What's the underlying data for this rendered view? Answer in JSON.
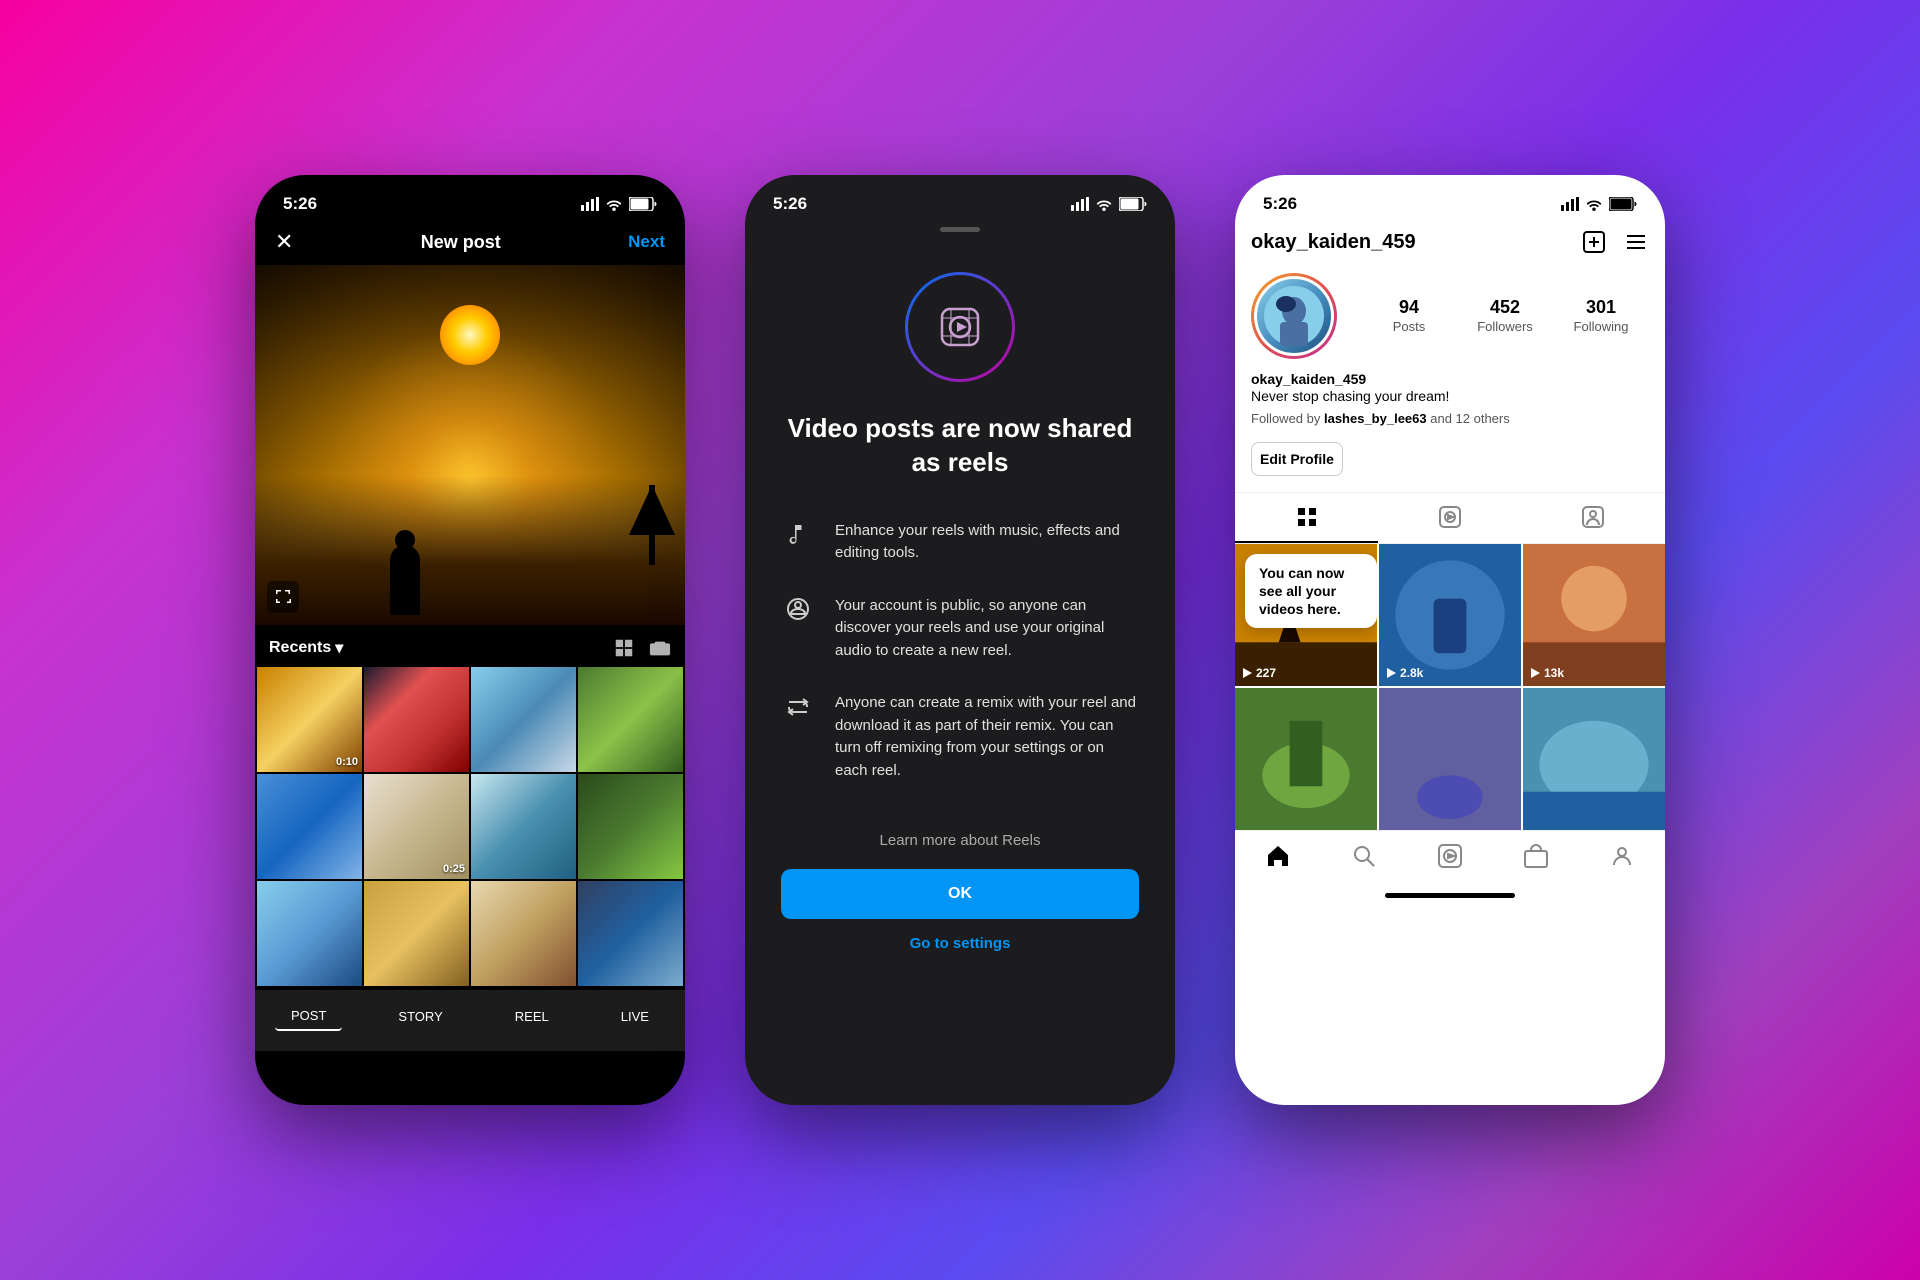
{
  "background": {
    "gradient": "pink-purple-blue"
  },
  "phone1": {
    "status_time": "5:26",
    "nav_title": "New post",
    "nav_next": "Next",
    "recents_label": "Recents",
    "photo_grid": [
      {
        "id": 1,
        "class": "gi-1",
        "duration": "0:10"
      },
      {
        "id": 2,
        "class": "gi-2",
        "duration": ""
      },
      {
        "id": 3,
        "class": "gi-3",
        "duration": ""
      },
      {
        "id": 4,
        "class": "gi-4",
        "duration": ""
      },
      {
        "id": 5,
        "class": "gi-5",
        "duration": ""
      },
      {
        "id": 6,
        "class": "gi-6",
        "duration": "0:25"
      },
      {
        "id": 7,
        "class": "gi-7",
        "duration": ""
      },
      {
        "id": 8,
        "class": "gi-8",
        "duration": ""
      },
      {
        "id": 9,
        "class": "gi-9",
        "duration": ""
      },
      {
        "id": 10,
        "class": "gi-10",
        "duration": ""
      },
      {
        "id": 11,
        "class": "gi-11",
        "duration": ""
      },
      {
        "id": 12,
        "class": "gi-12",
        "duration": ""
      }
    ],
    "tabs": [
      "POST",
      "STORY",
      "REEL",
      "LIVE"
    ]
  },
  "phone2": {
    "status_time": "5:26",
    "headline": "Video posts are now shared as reels",
    "features": [
      {
        "icon": "music-note",
        "text": "Enhance your reels with music, effects and editing tools."
      },
      {
        "icon": "person-circle",
        "text": "Your account is public, so anyone can discover your reels and use your original audio to create a new reel."
      },
      {
        "icon": "repost",
        "text": "Anyone can create a remix with your reel and download it as part of their remix. You can turn off remixing from your settings or on each reel."
      }
    ],
    "learn_more": "Learn more about Reels",
    "ok_button": "OK",
    "go_settings": "Go to settings"
  },
  "phone3": {
    "status_time": "5:26",
    "username": "okay_kaiden_459",
    "stats": {
      "posts": "94",
      "posts_label": "Posts",
      "followers": "452",
      "followers_label": "Followers",
      "following": "301",
      "following_label": "Following"
    },
    "bio_username": "okay_kaiden_459",
    "bio_text": "Never stop chasing your dream!",
    "bio_followed": "Followed by lashes_by_lee63 and 12 others",
    "edit_profile": "Edit Profile",
    "tooltip": "You can now see all your videos here.",
    "media_items": [
      {
        "class": "mi-1",
        "count": "227",
        "has_tooltip": true
      },
      {
        "class": "mi-2",
        "count": "2.8k",
        "has_tooltip": false
      },
      {
        "class": "mi-3",
        "count": "13k",
        "has_tooltip": false
      },
      {
        "class": "mi-4",
        "count": "",
        "has_tooltip": false
      },
      {
        "class": "mi-5",
        "count": "",
        "has_tooltip": false
      },
      {
        "class": "mi-6",
        "count": "",
        "has_tooltip": false
      }
    ]
  }
}
